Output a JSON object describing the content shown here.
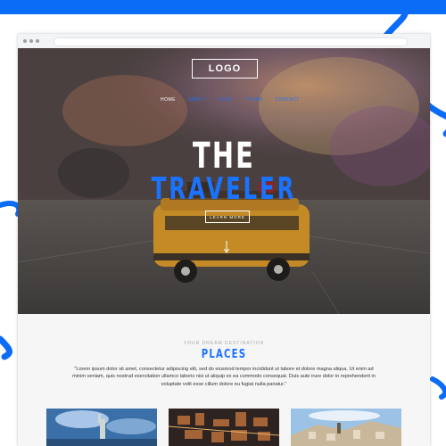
{
  "header": {
    "logo_text": "LOGO",
    "nav": [
      {
        "label": "HOME"
      },
      {
        "label": "ABOUT"
      },
      {
        "label": "BLOG"
      },
      {
        "label": "TOURS"
      },
      {
        "label": "CONTACT"
      }
    ]
  },
  "hero": {
    "title_line1": "THE",
    "title_line2": "TRAVELER",
    "button_label": "LEARN MORE"
  },
  "places_section": {
    "kicker": "YOUR DREAM DESTINATION",
    "heading": "PLACES",
    "description": "\"Lorem ipsum dolor sit amet, consectetur adipiscing elit, sed do eiusmod tempor incididunt ut labore et dolore magna aliqua. Ut enim ad minim veniam, quis nostrud exercitation ullamco laboris nisi ut aliquip ex ea commodo consequat. Duis aute irure dolor in reprehenderit in voluptate velit esse cillum dolore eu fugiat nulla pariatur.\""
  },
  "cards": [
    {
      "image": "statue-of-liberty"
    },
    {
      "image": "city-night-aerial"
    },
    {
      "image": "coastal-town"
    }
  ],
  "colors": {
    "accent": "#1a73ff",
    "brand_blue": "#0b6cf7",
    "section_bg": "#f6f6f6"
  }
}
